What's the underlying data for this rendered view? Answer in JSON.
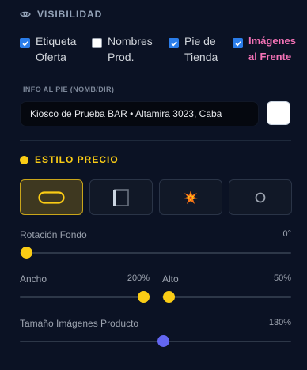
{
  "visibilidad": {
    "title": "VISIBILIDAD",
    "icon": "eye-icon",
    "checkboxes": [
      {
        "label": "Etiqueta Oferta",
        "checked": true,
        "highlight": false
      },
      {
        "label": "Nombres Prod.",
        "checked": false,
        "highlight": false
      },
      {
        "label": "Pie de Tienda",
        "checked": true,
        "highlight": false
      },
      {
        "label": "Imágenes al Frente",
        "checked": true,
        "highlight": true
      }
    ]
  },
  "info_pie": {
    "title": "INFO AL PIE (NOMB/DIR)",
    "value": "Kiosco de Prueba BAR • Altamira 3023, Caba",
    "swatch_color": "#ffffff"
  },
  "estilo_precio": {
    "title": "ESTILO PRECIO",
    "options": [
      {
        "name": "pill-style",
        "active": true
      },
      {
        "name": "square-style",
        "active": false
      },
      {
        "name": "explosion-style",
        "active": false
      },
      {
        "name": "circle-style",
        "active": false
      }
    ]
  },
  "sliders": {
    "rotacion": {
      "label": "Rotación Fondo",
      "value": "0°",
      "fraction": 0.0
    },
    "ancho": {
      "label": "Ancho",
      "value": "200%",
      "fraction": 0.95
    },
    "alto": {
      "label": "Alto",
      "value": "50%",
      "fraction": 0.05
    },
    "tamano": {
      "label": "Tamaño Imágenes Producto",
      "value": "130%",
      "fraction": 0.53
    }
  },
  "colors": {
    "accent_yellow": "#facc15",
    "checkbox_blue": "#2b7de9",
    "highlight_pink": "#f472b6",
    "slider_violet": "#6366f1"
  }
}
